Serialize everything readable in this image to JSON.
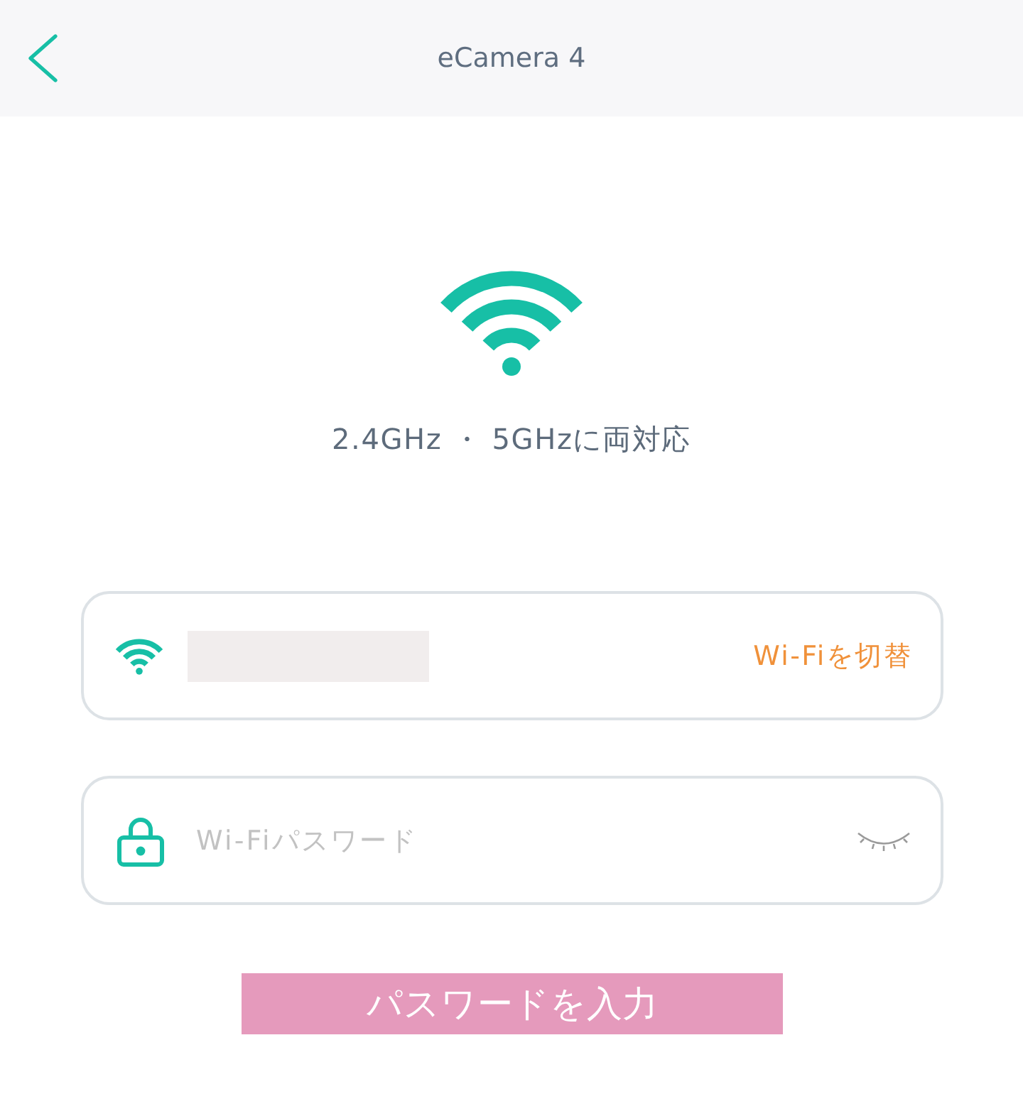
{
  "header": {
    "title": "eCamera 4"
  },
  "hero": {
    "caption": "2.4GHz ・ 5GHzに両対応"
  },
  "network_field": {
    "switch_link": "Wi-Fiを切替"
  },
  "password_field": {
    "placeholder": "Wi-Fiパスワード",
    "password_visible": false
  },
  "caption_banner": {
    "text": "パスワードを入力"
  }
}
